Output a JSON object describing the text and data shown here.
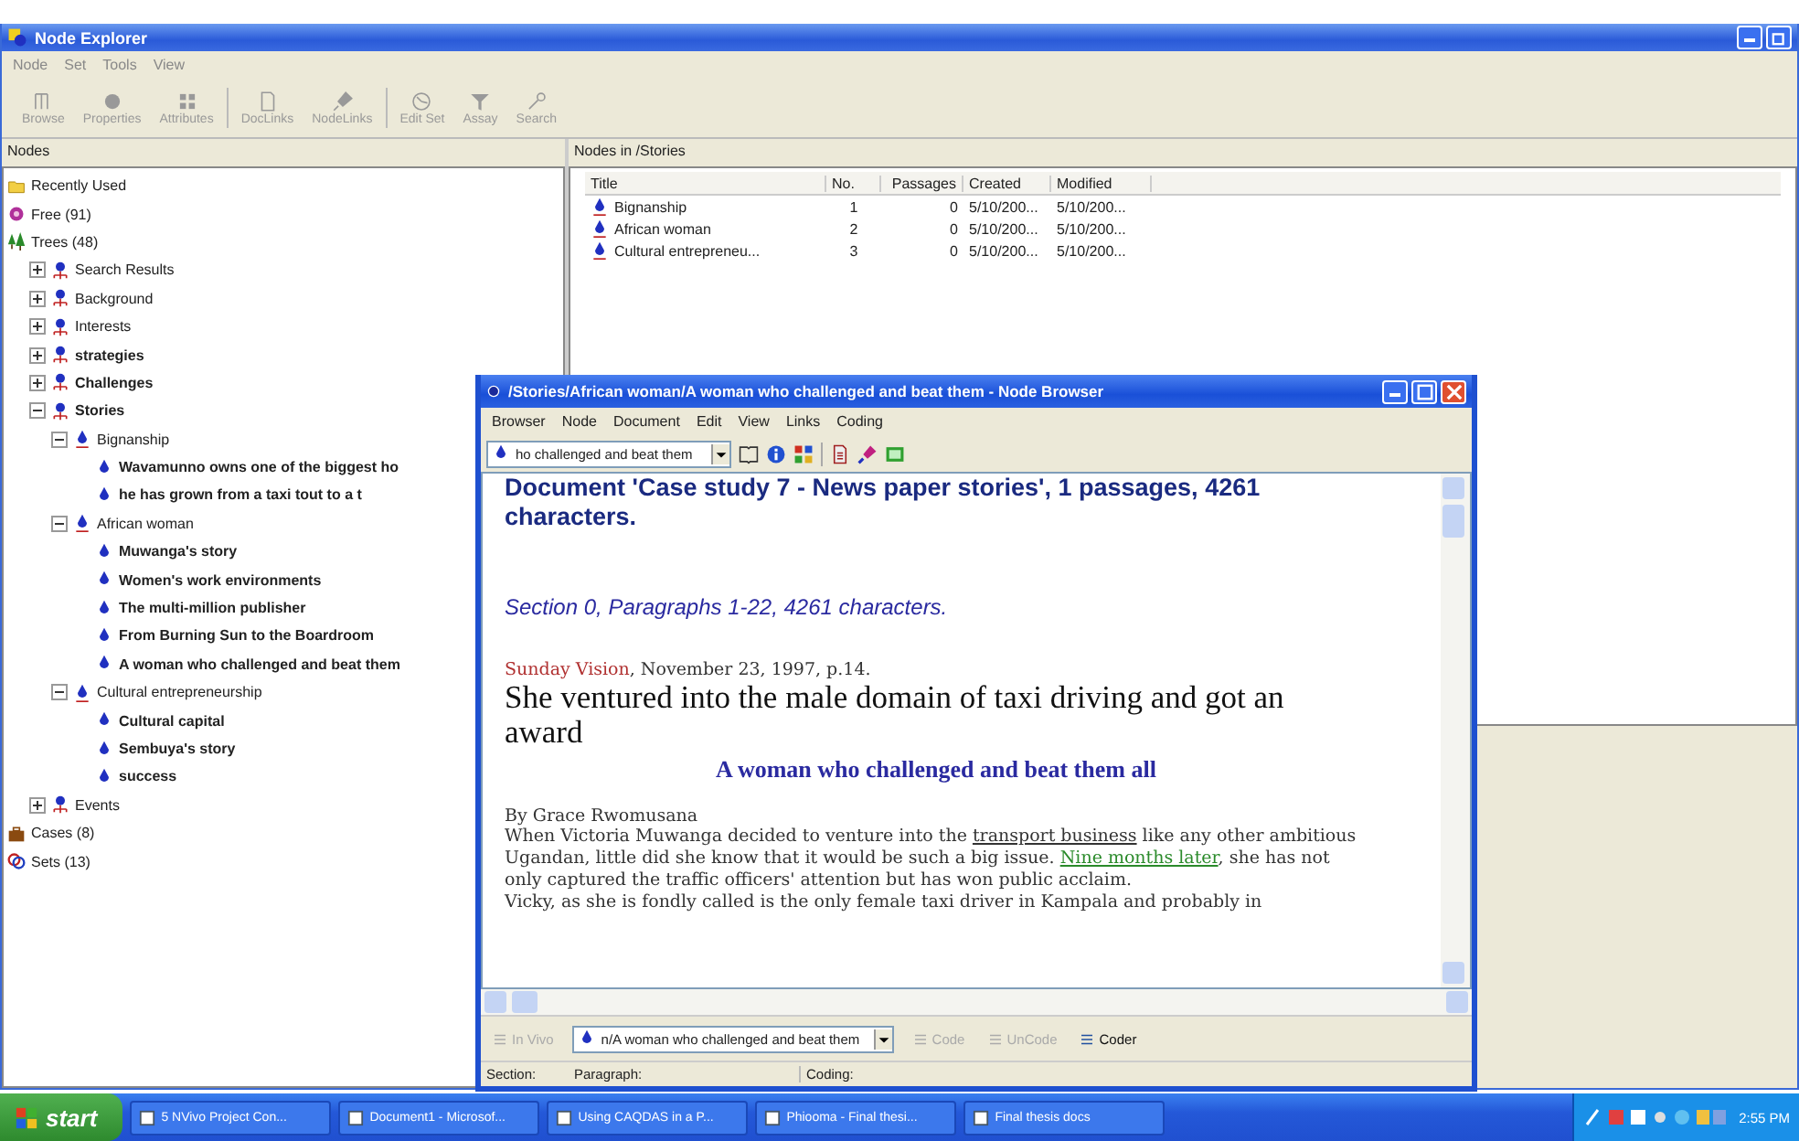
{
  "window": {
    "title": "Node Explorer"
  },
  "menu": [
    "Node",
    "Set",
    "Tools",
    "View"
  ],
  "toolbar": [
    {
      "label": "Browse",
      "disabled": true
    },
    {
      "label": "Properties",
      "disabled": true
    },
    {
      "label": "Attributes",
      "disabled": true
    },
    {
      "label": "DocLinks",
      "disabled": true
    },
    {
      "label": "NodeLinks",
      "disabled": true
    },
    {
      "label": "Edit Set",
      "disabled": true
    },
    {
      "label": "Assay",
      "disabled": true
    },
    {
      "label": "Search",
      "disabled": true
    }
  ],
  "nodes_pane": {
    "title": "Nodes"
  },
  "tree": [
    {
      "label": "Recently Used",
      "kind": "folder",
      "bold": false
    },
    {
      "label": "Free (91)",
      "kind": "free",
      "bold": false
    },
    {
      "label": "Trees (48)",
      "kind": "trees",
      "bold": false,
      "children": [
        {
          "label": "Search Results",
          "kind": "tree",
          "bold": false,
          "expanded": false
        },
        {
          "label": "Background",
          "kind": "tree",
          "bold": false,
          "expanded": false
        },
        {
          "label": "Interests",
          "kind": "tree",
          "bold": false,
          "expanded": false
        },
        {
          "label": "strategies",
          "kind": "tree",
          "bold": true,
          "expanded": false
        },
        {
          "label": "Challenges",
          "kind": "tree",
          "bold": true,
          "expanded": false
        },
        {
          "label": "Stories",
          "kind": "tree",
          "bold": true,
          "expanded": true,
          "children": [
            {
              "label": "Bignanship",
              "kind": "node",
              "bold": false,
              "expanded": true,
              "children": [
                {
                  "label": "Wavamunno owns one of the biggest ho",
                  "kind": "leaf",
                  "bold": true
                },
                {
                  "label": "he has grown from a taxi tout to a t",
                  "kind": "leaf",
                  "bold": true
                }
              ]
            },
            {
              "label": "African woman",
              "kind": "node",
              "bold": false,
              "expanded": true,
              "children": [
                {
                  "label": "Muwanga's story",
                  "kind": "leaf",
                  "bold": true
                },
                {
                  "label": "Women's work environments",
                  "kind": "leaf",
                  "bold": true
                },
                {
                  "label": "The multi-million publisher",
                  "kind": "leaf",
                  "bold": true
                },
                {
                  "label": "From Burning Sun to the Boardroom",
                  "kind": "leaf",
                  "bold": true
                },
                {
                  "label": "A woman who challenged and beat them",
                  "kind": "leaf",
                  "bold": true
                }
              ]
            },
            {
              "label": "Cultural entrepreneurship",
              "kind": "node",
              "bold": false,
              "expanded": true,
              "children": [
                {
                  "label": "Cultural capital",
                  "kind": "leaf",
                  "bold": true
                },
                {
                  "label": "Sembuya's story",
                  "kind": "leaf",
                  "bold": true
                },
                {
                  "label": "success",
                  "kind": "leaf",
                  "bold": true
                }
              ]
            }
          ]
        },
        {
          "label": "Events",
          "kind": "tree",
          "bold": false,
          "expanded": false
        }
      ]
    },
    {
      "label": "Cases (8)",
      "kind": "cases",
      "bold": false
    },
    {
      "label": "Sets (13)",
      "kind": "sets",
      "bold": false
    }
  ],
  "list_pane": {
    "title": "Nodes in /Stories"
  },
  "table": {
    "columns": [
      "Title",
      "No.",
      "Passages",
      "Created",
      "Modified"
    ],
    "rows": [
      [
        "Bignanship",
        "1",
        "0",
        "5/10/200...",
        "5/10/200..."
      ],
      [
        "African woman",
        "2",
        "0",
        "5/10/200...",
        "5/10/200..."
      ],
      [
        "Cultural entrepreneu...",
        "3",
        "0",
        "5/10/200...",
        "5/10/200..."
      ]
    ]
  },
  "browser": {
    "title": "/Stories/African woman/A woman who challenged and beat them - Node Browser",
    "menu": [
      "Browser",
      "Node",
      "Document",
      "Edit",
      "View",
      "Links",
      "Coding"
    ],
    "node_select": "ho challenged and beat them",
    "document": {
      "heading": "Document 'Case study 7 - News paper stories',  1 passages, 4261 characters.",
      "section": "Section 0, Paragraphs 1-22, 4261 characters.",
      "source": "Sunday Vision",
      "dateline": ", November 23, 1997, p.14.",
      "headline": "She ventured into the male domain of taxi driving and got an award",
      "subhead": "A woman who challenged and beat them all",
      "byline": "By Grace Rwomusana",
      "paragraph": [
        {
          "kind": "plain",
          "text": "When Victoria Muwanga decided to venture into the "
        },
        {
          "kind": "link",
          "text": "transport business"
        },
        {
          "kind": "plain",
          "text": " like any other ambitious Ugandan, little did she know that it would be such a big issue. "
        },
        {
          "kind": "coded",
          "text": "Nine months later"
        },
        {
          "kind": "plain",
          "text": ", she has not only captured the traffic officers' attention but has won public acclaim."
        }
      ],
      "cut_line": "Vicky, as she is fondly called is the only female taxi driver in Kampala and probably in"
    },
    "bottom_toolbar": [
      {
        "kind": "button",
        "label": "In Vivo",
        "disabled": true
      },
      {
        "kind": "select",
        "label": "n/A woman who challenged and beat them"
      },
      {
        "kind": "button",
        "label": "Code",
        "disabled": true
      },
      {
        "kind": "button",
        "label": "UnCode",
        "disabled": true
      },
      {
        "kind": "button",
        "label": "Coder",
        "disabled": false
      }
    ],
    "status": [
      "Section:",
      "Paragraph:",
      "Coding:"
    ]
  },
  "taskbar": {
    "start": "start",
    "tasks": [
      "5 NVivo Project Con...",
      "Document1 - Microsof...",
      "Using CAQDAS in a P...",
      "Phiooma - Final thesi...",
      "Final thesis docs"
    ],
    "clock": "2:55 PM"
  }
}
